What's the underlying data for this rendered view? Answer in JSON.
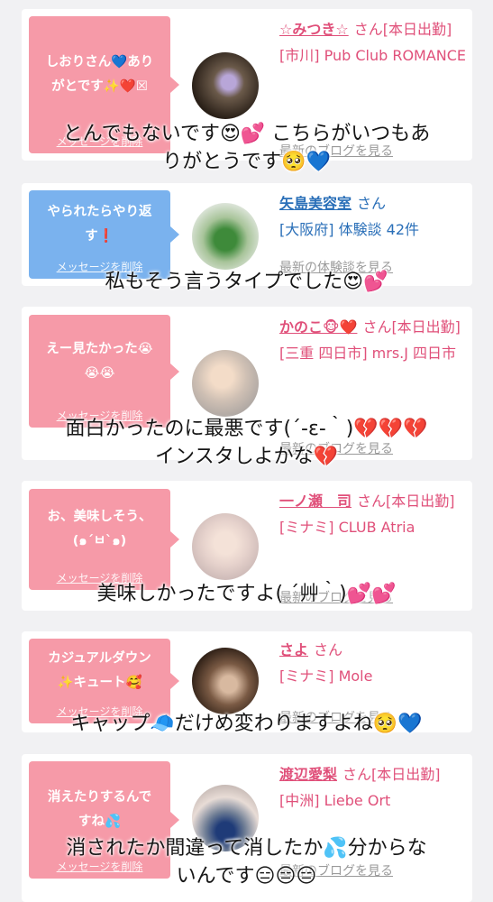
{
  "messages": [
    {
      "bubble_text": "しおりさん💙あり\nがとです✨❤️☒",
      "delete_label": "メッセージを削除",
      "name": "☆みつき☆",
      "suffix": "さん[本日出勤]",
      "location": "[市川] Pub Club ROMANCE",
      "link": "最新のブログを見る",
      "caption": "とんでもないです😍💕 こちらがいつもあ\nりがとうです🥺💙"
    },
    {
      "bubble_text": "やられたらやり返\nす❗",
      "delete_label": "メッセージを削除",
      "name": "矢島美容室",
      "suffix": "さん",
      "location": "[大阪府] 体験談 42件",
      "link": "最新の体験談を見る",
      "caption": "私もそう言うタイプでした😍💕"
    },
    {
      "bubble_text": "えー見たかった😭\n😭😭",
      "delete_label": "メッセージを削除",
      "name": "かのこ🐵❤️",
      "suffix": "さん[本日出勤]",
      "location": "[三重 四日市] mrs.J 四日市",
      "link": "最新のブログを見る",
      "caption": "面白かったのに最悪です(´-ε-｀)💔💔💔\nインスタしよかな💔"
    },
    {
      "bubble_text": "お、美味しそう、\n(๑´ㅂ`๑)",
      "delete_label": "メッセージを削除",
      "name": "一ノ瀬　司",
      "suffix": "さん[本日出勤]",
      "location": "[ミナミ] CLUB Atria",
      "link": "最新のブログを見る",
      "caption": "美味しかったですよ( ´艸｀)💕💕"
    },
    {
      "bubble_text": "カジュアルダウン\n✨キュート🥰",
      "delete_label": "メッセージを削除",
      "name": "さよ",
      "suffix": "さん",
      "location": "[ミナミ] Mole",
      "link": "最新のブログを見る",
      "caption": "キャップ🧢だけめ変わりますよね🥺💙"
    },
    {
      "bubble_text": "消えたりするんで\nすね💦",
      "delete_label": "メッセージを削除",
      "name": "渡辺愛梨",
      "suffix": "さん[本日出勤]",
      "location": "[中洲] Liebe Ort",
      "link": "最新のブログを見る",
      "caption": "消されたか間違って消したか💦分からな\nいんです😑😑😑"
    }
  ],
  "colors": {
    "pink_bubble": "#f69aa8",
    "blue_bubble": "#7ab2ee",
    "pink_text": "#e0507a",
    "blue_text": "#2a6fb8"
  }
}
